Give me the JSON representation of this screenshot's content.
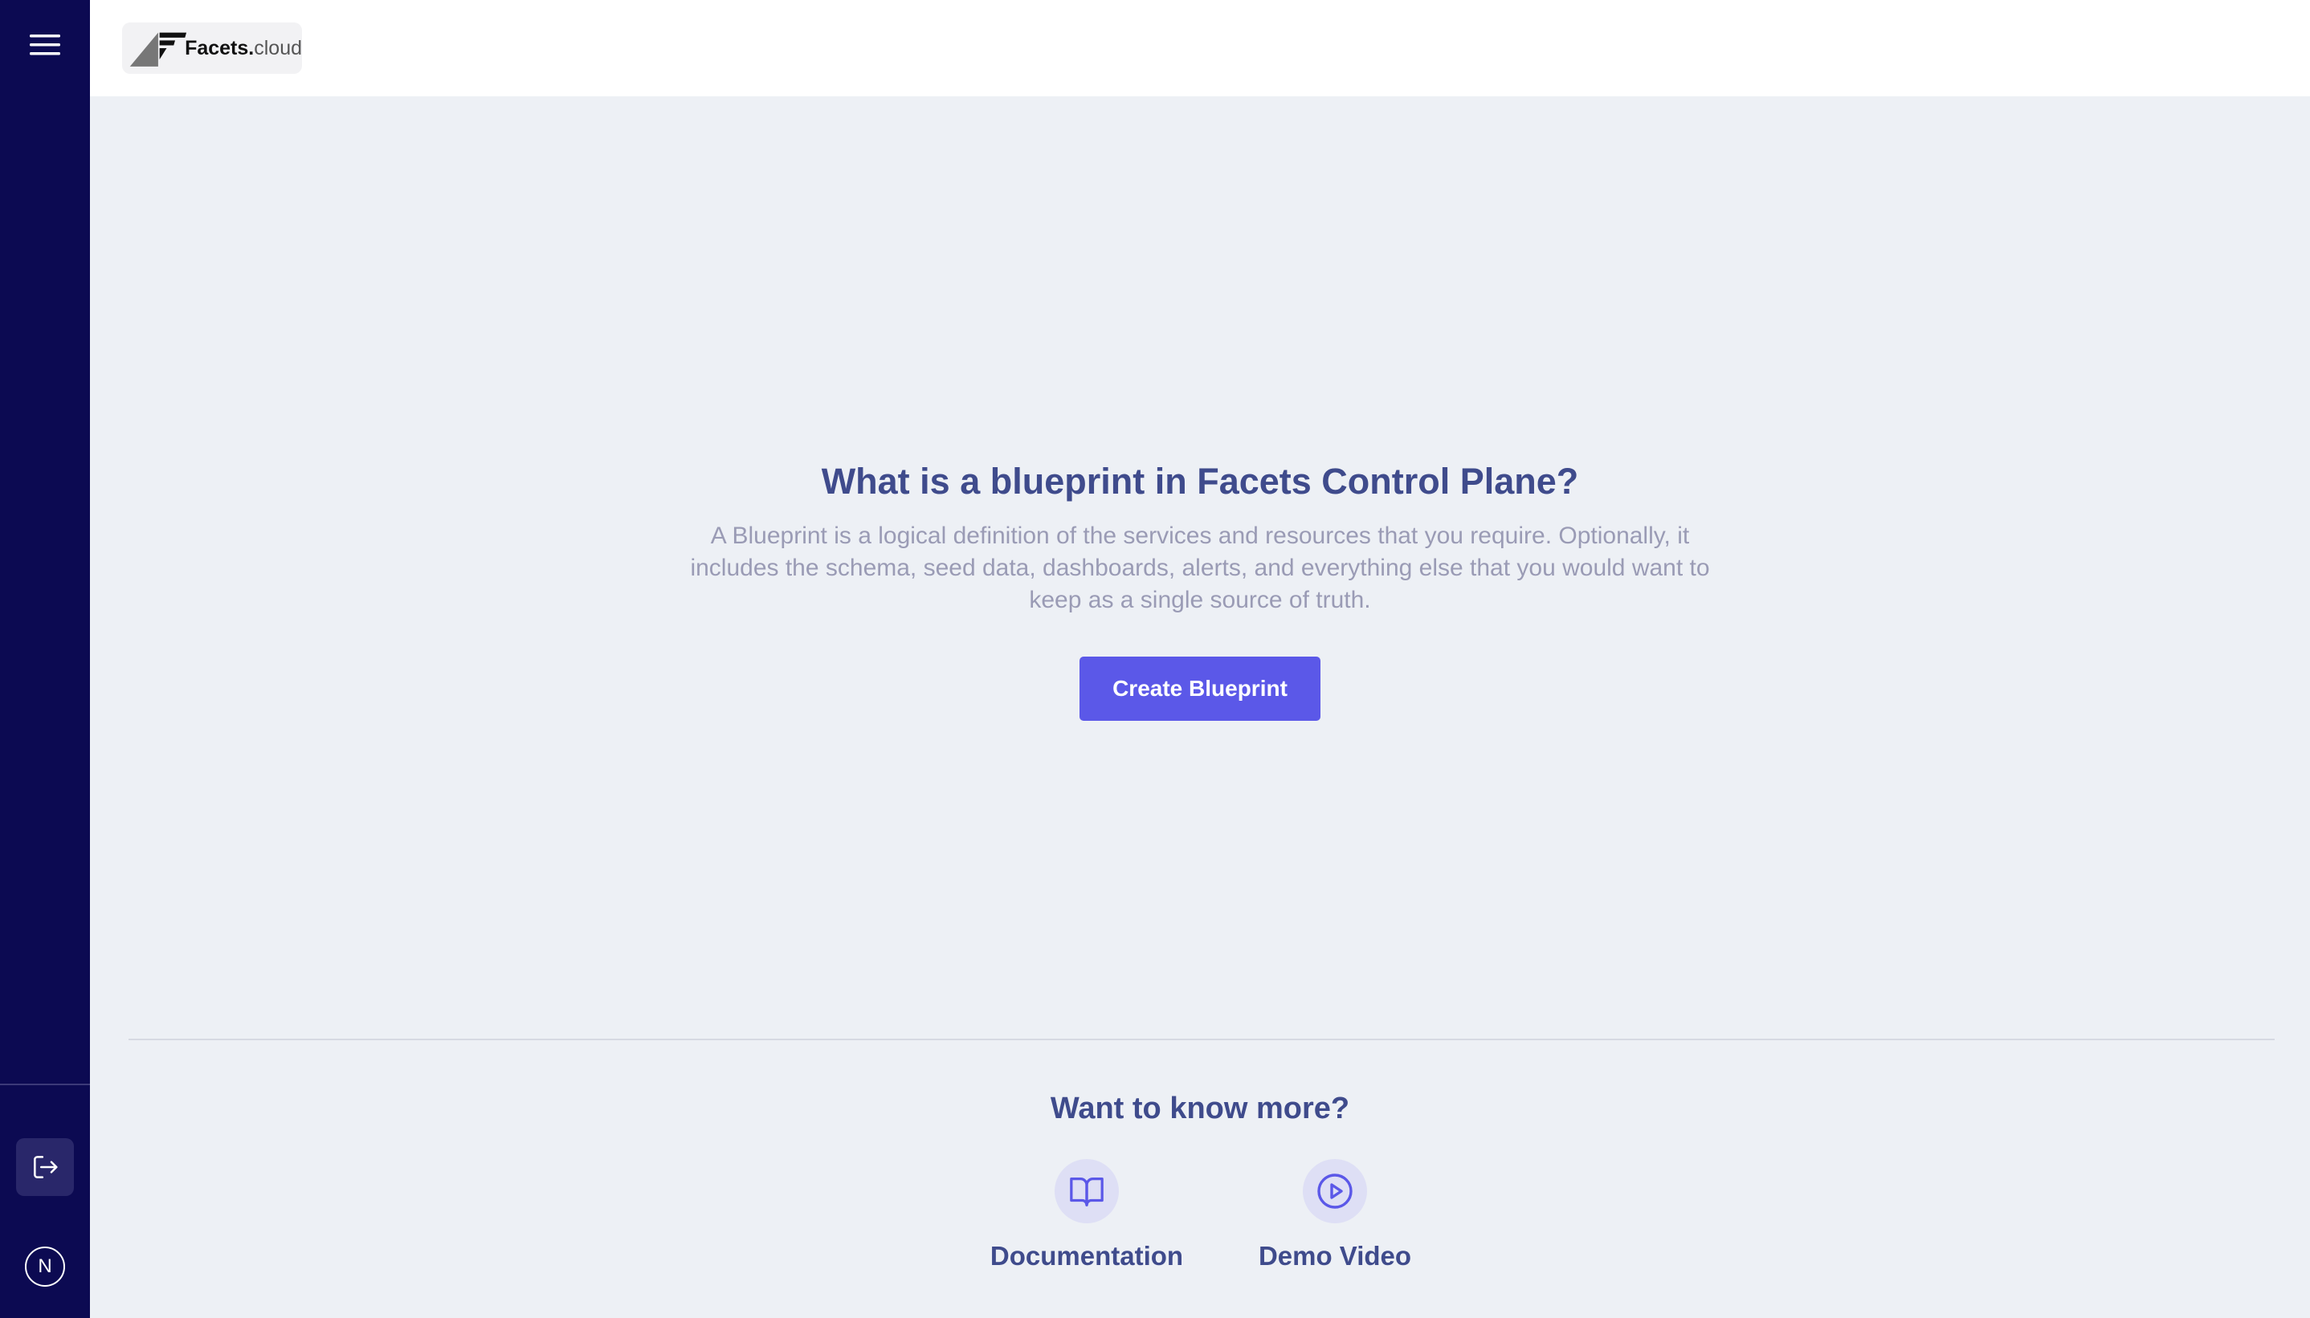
{
  "sidebar": {
    "menu_icon": "hamburger-menu-icon",
    "logout_icon": "logout-icon",
    "avatar_initial": "N",
    "colors": {
      "background": "#0c0a52",
      "logout_bg": "#29276a"
    }
  },
  "header": {
    "logo_main": "Facets.",
    "logo_sub": "cloud"
  },
  "hero": {
    "title": "What is a blueprint in Facets Control Plane?",
    "description": "A Blueprint is a logical definition of the services and resources that you require. Optionally, it includes the schema, seed data, dashboards, alerts, and everything else that you would want to keep as a single source of truth.",
    "cta_label": "Create Blueprint",
    "accent_color": "#5b58e8"
  },
  "more": {
    "title": "Want to know more?",
    "links": [
      {
        "label": "Documentation",
        "icon": "book-open-icon"
      },
      {
        "label": "Demo Video",
        "icon": "play-circle-icon"
      }
    ]
  }
}
